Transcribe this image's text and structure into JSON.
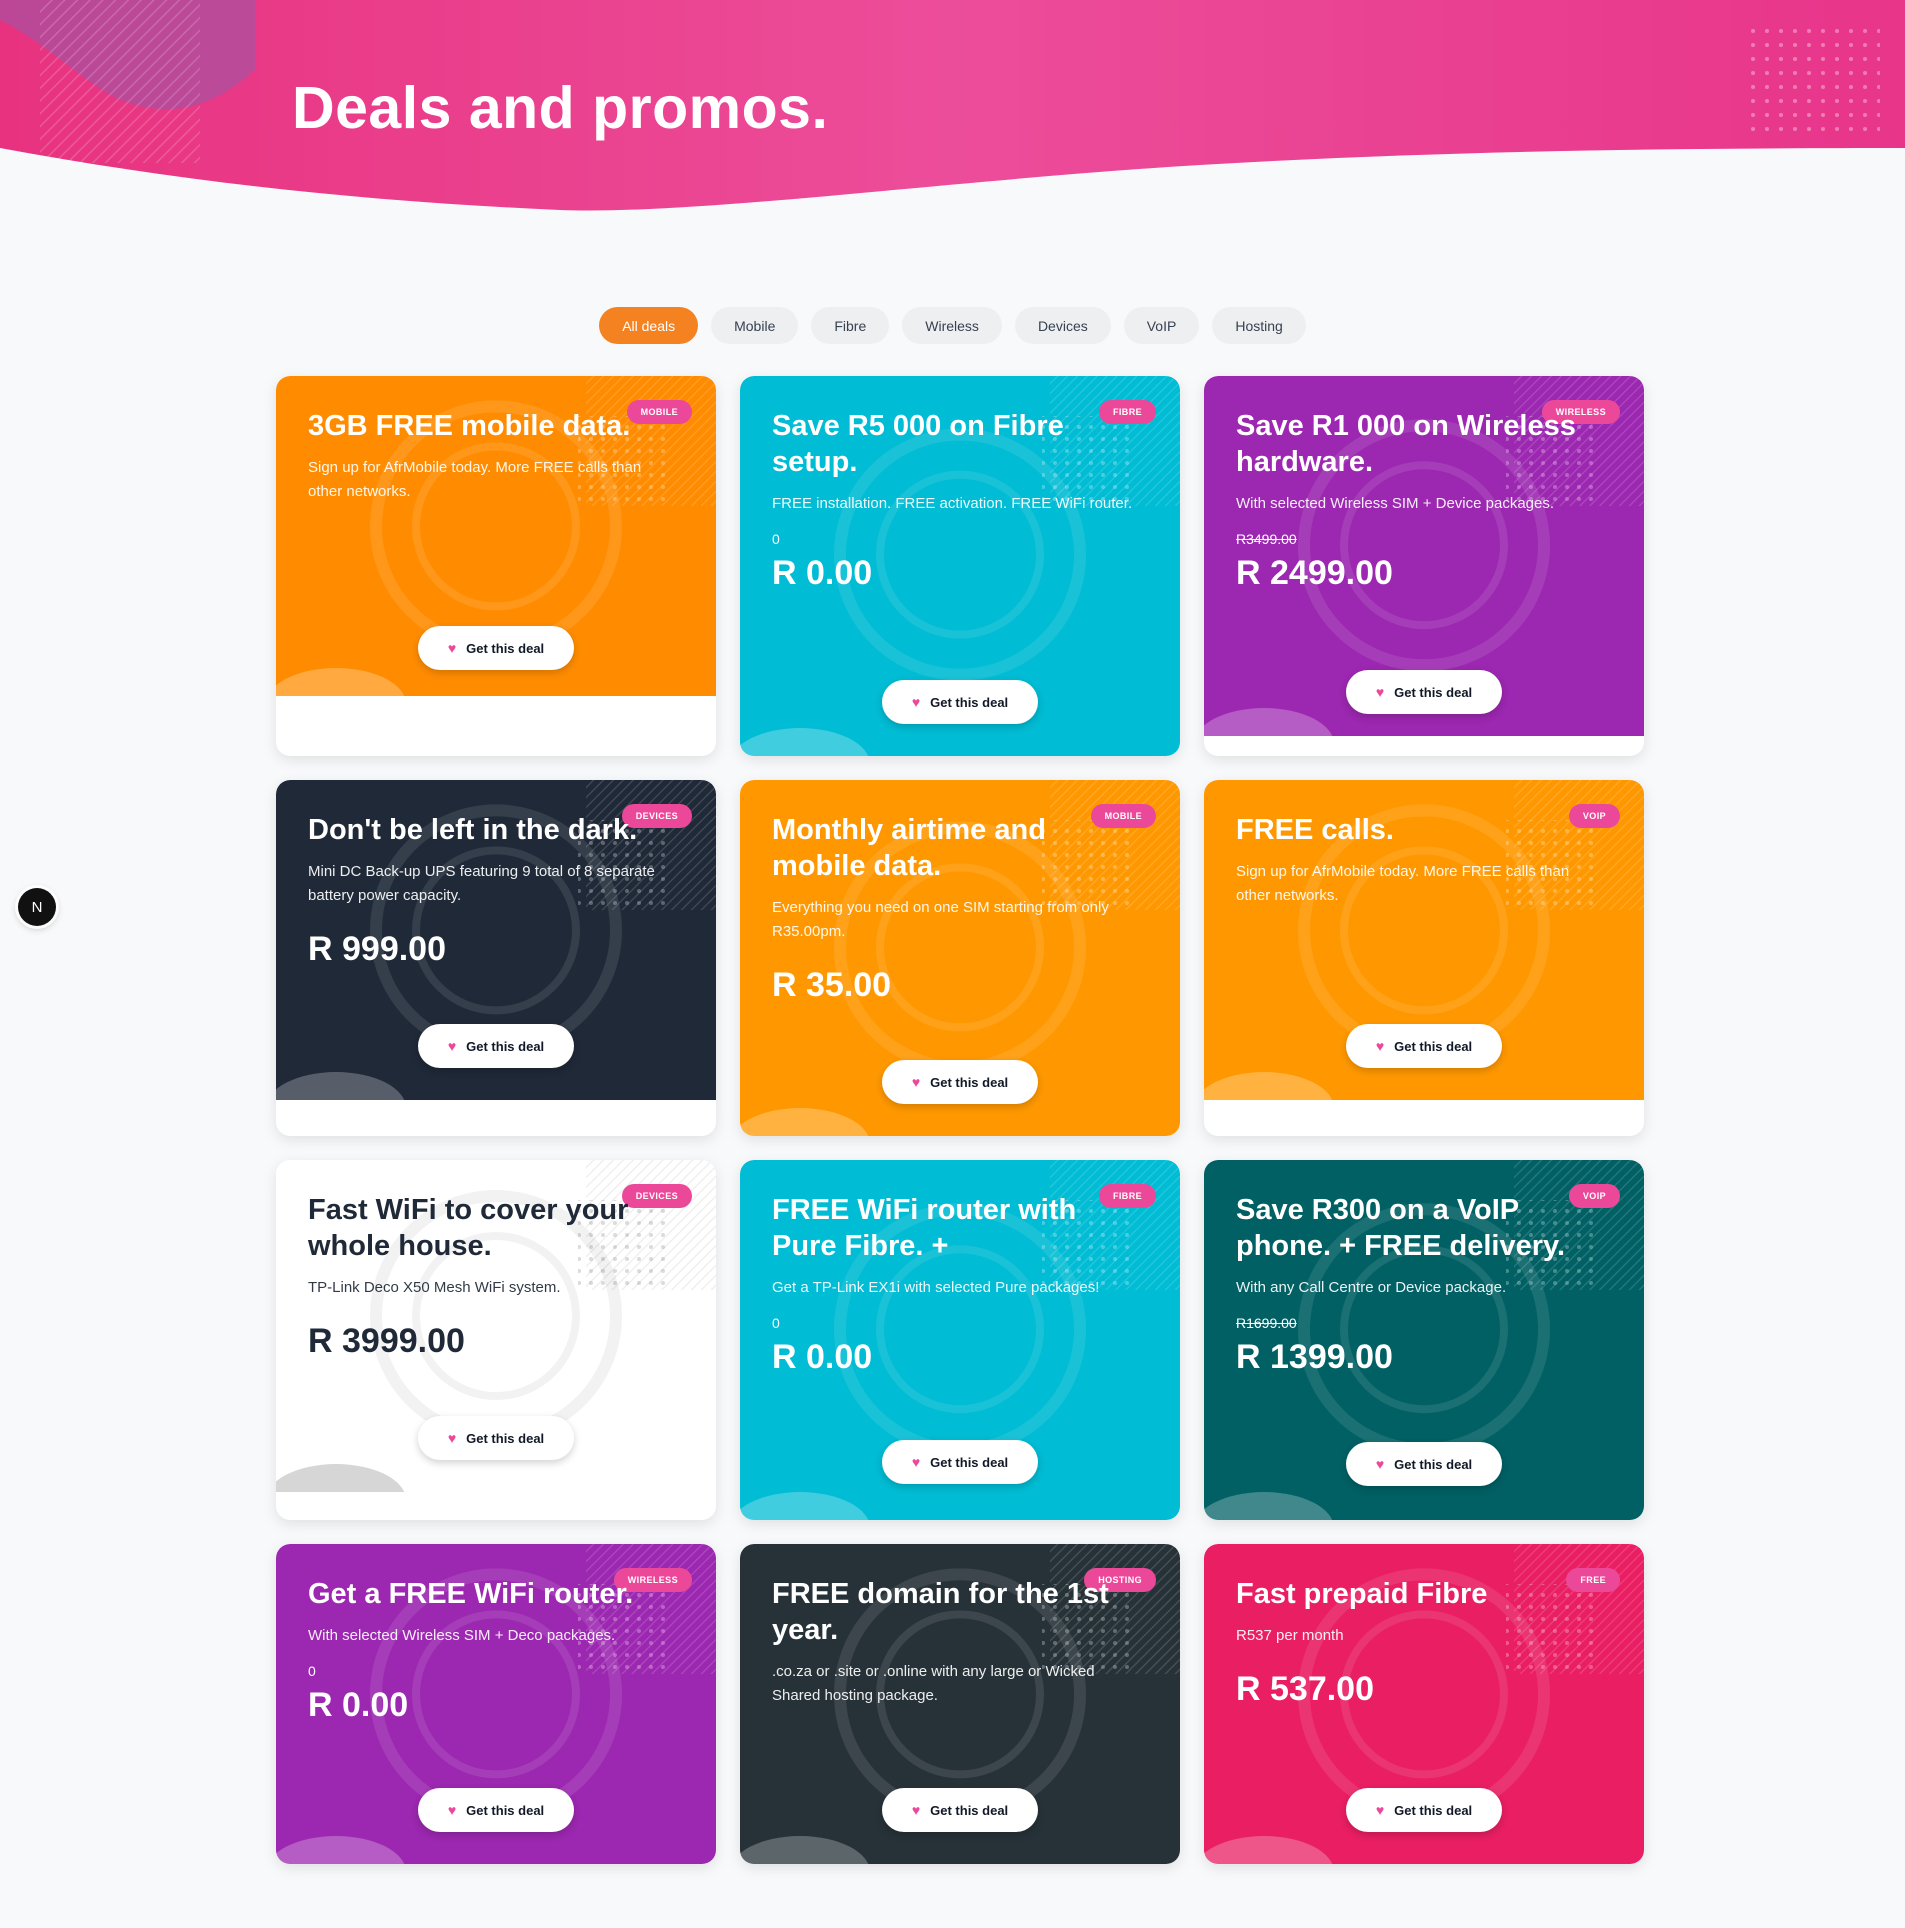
{
  "hero": {
    "title": "Deals and promos."
  },
  "filters": [
    {
      "label": "All deals",
      "active": true
    },
    {
      "label": "Mobile"
    },
    {
      "label": "Fibre"
    },
    {
      "label": "Wireless"
    },
    {
      "label": "Devices"
    },
    {
      "label": "VoIP"
    },
    {
      "label": "Hosting"
    }
  ],
  "cta_label": "Get this deal",
  "side_button": {
    "label": "N"
  },
  "deals": [
    {
      "badge": "MOBILE",
      "title": "3GB FREE mobile data.",
      "description": "Sign up for AfrMobile today. More FREE calls than other networks.",
      "bg": "#ff8c00",
      "text": "light"
    },
    {
      "badge": "FIBRE",
      "title": "Save R5 000 on Fibre setup.",
      "description": "FREE installation. FREE activation. FREE WiFi router.",
      "extra": "0",
      "price": "R 0.00",
      "bg": "#00bcd4",
      "text": "light"
    },
    {
      "badge": "WIRELESS",
      "title": "Save R1 000 on Wireless hardware.",
      "description": "With selected Wireless SIM + Device packages.",
      "old_price": "R3499.00",
      "price": "R 2499.00",
      "bg": "#9c27b0",
      "text": "light"
    },
    {
      "badge": "DEVICES",
      "title": "Don't be left in the dark.",
      "description": "Mini DC Back-up UPS featuring 9 total of 8 separate battery power capacity.",
      "price": "R 999.00",
      "bg": "#1f2937",
      "text": "light"
    },
    {
      "badge": "MOBILE",
      "title": "Monthly airtime and mobile data.",
      "description": "Everything you need on one SIM starting from only R35.00pm.",
      "price": "R 35.00",
      "bg": "#ff9800",
      "text": "light"
    },
    {
      "badge": "VOIP",
      "title": "FREE calls.",
      "description": "Sign up for AfrMobile today. More FREE calls than other networks.",
      "bg": "#ff9800",
      "text": "light"
    },
    {
      "badge": "DEVICES",
      "title": "Fast WiFi to cover your whole house.",
      "description": "TP-Link Deco X50 Mesh WiFi system.",
      "price": "R 3999.00",
      "bg": "#ffffff",
      "text": "dark"
    },
    {
      "badge": "FIBRE",
      "title": "FREE WiFi router with Pure Fibre. +",
      "description": "Get a TP-Link EX1i with selected Pure packages!",
      "extra": "0",
      "price": "R 0.00",
      "bg": "#00bcd4",
      "text": "light"
    },
    {
      "badge": "VOIP",
      "title": "Save R300 on a VoIP phone. + FREE delivery.",
      "description": "With any Call Centre or Device package.",
      "old_price": "R1699.00",
      "price": "R 1399.00",
      "bg": "#006064",
      "text": "light"
    },
    {
      "badge": "WIRELESS",
      "title": "Get a FREE WiFi router.",
      "description": "With selected Wireless SIM + Deco packages.",
      "extra": "0",
      "price": "R 0.00",
      "bg": "#9c27b0",
      "text": "light"
    },
    {
      "badge": "HOSTING",
      "title": "FREE domain for the 1st year.",
      "description": ".co.za or .site or .online with any large or Wicked Shared hosting package.",
      "bg": "#263238",
      "text": "light"
    },
    {
      "badge": "FREE",
      "title": "Fast prepaid Fibre",
      "description": "R537 per month",
      "price": "R 537.00",
      "bg": "#e91e63",
      "text": "light"
    }
  ]
}
